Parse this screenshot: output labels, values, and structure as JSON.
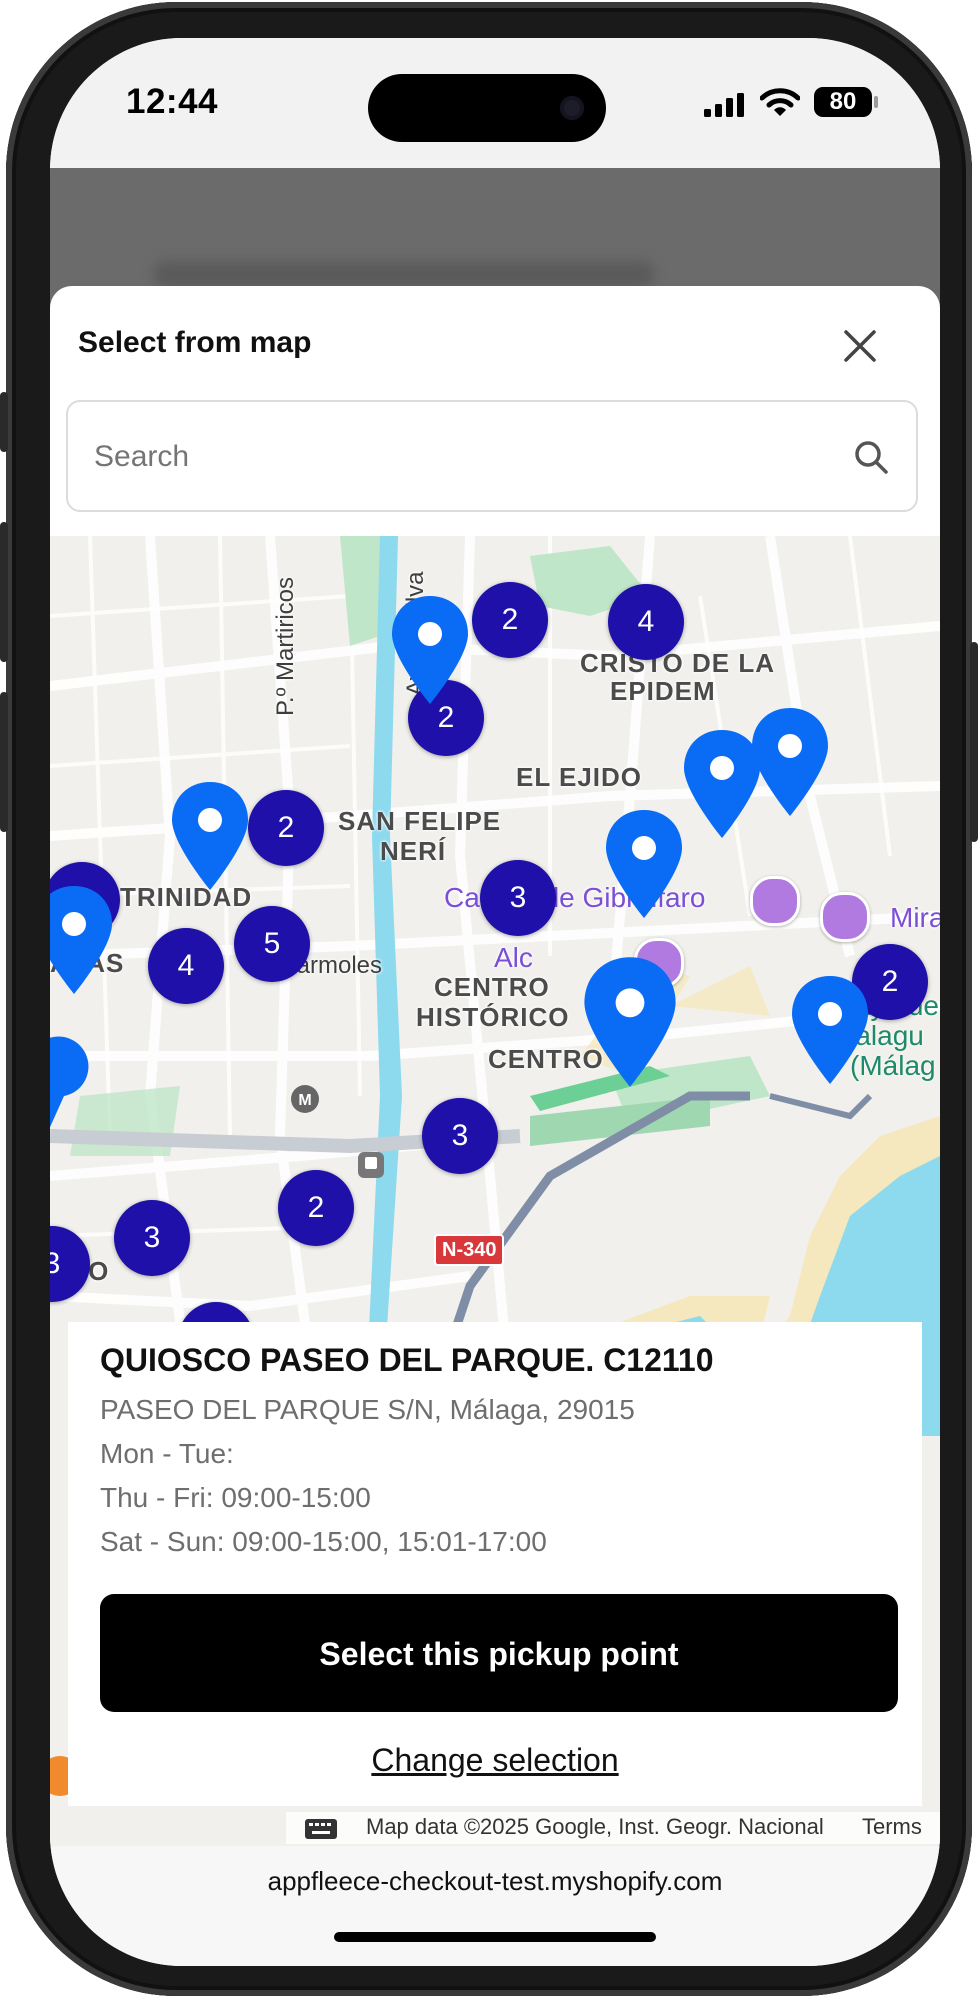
{
  "status_bar": {
    "time": "12:44",
    "battery": "80"
  },
  "modal": {
    "title": "Select from map",
    "search": {
      "placeholder": "Search",
      "value": ""
    }
  },
  "map": {
    "district_labels": [
      "CRISTO DE LA",
      "EPIDEM",
      "EL EJIDO",
      "SAN FELIPE",
      "NERÍ",
      "TRINIDAD",
      "APAS",
      "CENTRO",
      "HISTÓRICO",
      "CENTRO",
      "ERO"
    ],
    "street_labels": [
      "P.º Martiricos",
      "Av. de Silva",
      "C. Mármoles"
    ],
    "poi_labels": [
      "Castillo de Gibralfaro",
      "Alc",
      "Mira"
    ],
    "beach_labels": [
      "Playa de",
      "Malagu",
      "(Málag"
    ],
    "road_sign": "N-340",
    "clusters": [
      "2",
      "4",
      "2",
      "2",
      "4",
      "3",
      "4",
      "5",
      "2",
      "3",
      "3",
      "2",
      "3"
    ],
    "attribution": "Map data ©2025 Google, Inst. Geogr. Nacional",
    "terms": "Terms"
  },
  "pickup_point": {
    "name": "QUIOSCO PASEO DEL PARQUE. C12110",
    "address": "PASEO DEL PARQUE S/N, Málaga, 29015",
    "hours": [
      "Mon - Tue:",
      "Thu - Fri: 09:00-15:00",
      "Sat - Sun: 09:00-15:00, 15:01-17:00"
    ],
    "select_button": "Select this pickup point",
    "change_link": "Change selection"
  },
  "browser": {
    "url": "appfleece-checkout-test.myshopify.com"
  },
  "colors": {
    "cluster": "#1e10a8",
    "pin": "#0a6cf5",
    "water": "#8dd9ee",
    "park": "#bfe6c8",
    "button": "#000000"
  }
}
